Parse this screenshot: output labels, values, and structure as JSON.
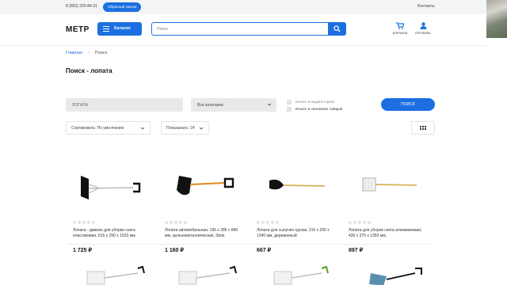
{
  "topbar": {
    "phone": "8 (863) 329-84-31",
    "callback_label": "Обратный звонок",
    "contacts_label": "Контакты"
  },
  "header": {
    "logo": "МЕТР",
    "catalog_label": "Каталог",
    "search_placeholder": "Поиск",
    "cart_label": "КОРЗИНА",
    "profile_label": "ПРОФИЛЬ"
  },
  "breadcrumb": {
    "home": "Главная",
    "current": "Поиск"
  },
  "page_title": "Поиск - лопата",
  "filters": {
    "query_value": "ЛОПАТА",
    "category_value": "Все категории",
    "check_subcategories": "Искать в подкатегориях",
    "check_descriptions": "Искать в описаниях товаров",
    "search_button": "ПОИСК"
  },
  "sorting": {
    "sort_label": "Сортировать: По умолчанию",
    "per_page_label": "Показывать: 24"
  },
  "products": [
    {
      "name": "Лопата - движок для уборки снега пластиковая, 615 х 290 х 1520 мм,",
      "price": "1 725 ₽"
    },
    {
      "name": "Лопата автомобильная, 195 х 285 х 840 мм, цельнометаллическая, Stels",
      "price": "1 160 ₽"
    },
    {
      "name": "Лопата для сыпучих грузов, 215 х 290 х 1340 мм, деревянный",
      "price": "667 ₽"
    },
    {
      "name": "Лопата для уборки снега алюминиевая, 430 х 370 х 1350 мм,",
      "price": "897 ₽"
    }
  ],
  "colors": {
    "accent": "#1b6fe0",
    "topbar_bg": "#f3f4f6",
    "field_bg": "#e9e9e9"
  }
}
